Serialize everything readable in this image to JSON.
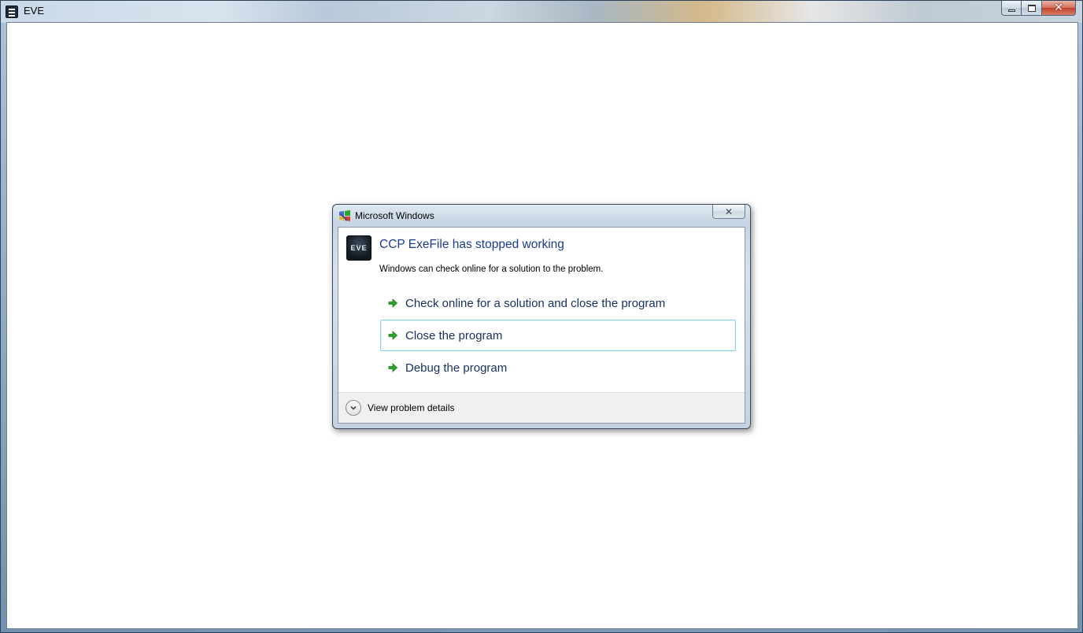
{
  "main_window": {
    "title": "EVE"
  },
  "dialog": {
    "title": "Microsoft Windows",
    "close_glyph": "✕",
    "app_icon_text": "EVE",
    "main_instruction": "CCP ExeFile has stopped working",
    "content": "Windows can check online for a solution to the problem.",
    "command_links": [
      {
        "label": "Check online for a solution and close the program"
      },
      {
        "label": "Close the program"
      },
      {
        "label": "Debug the program"
      }
    ],
    "footer": {
      "expand_label": "View problem details"
    }
  },
  "icons": {
    "system_menu": "system-menu-icon",
    "dialog_icon": "windows-dialog-icon",
    "command_arrow": "green-arrow-icon",
    "expand": "chevron-down-icon"
  },
  "colors": {
    "instruction_text": "#1a3a8c",
    "command_link_text": "#15305e",
    "arrow_green": "#2aa52a",
    "focus_border": "#80d4e6"
  }
}
